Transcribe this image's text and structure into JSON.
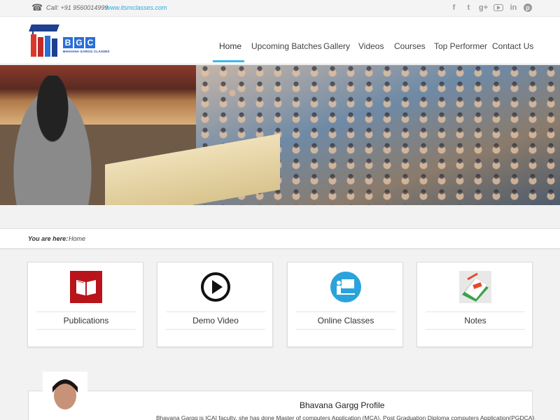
{
  "topbar": {
    "call": "Call: +91 9560014999",
    "site": "www.itsmclasses.com",
    "social_icons": [
      "facebook-icon",
      "twitter-icon",
      "google-plus-icon",
      "youtube-icon",
      "linkedin-icon",
      "pinterest-icon"
    ],
    "social_glyphs": {
      "facebook": "f",
      "twitter": "t",
      "google": "g+",
      "linkedin": "in",
      "pinterest": "p"
    }
  },
  "logo": {
    "letters": [
      "B",
      "G",
      "C"
    ],
    "letter_colors": [
      "#2a6fd6",
      "#2a6fd6",
      "#2a6fd6"
    ],
    "tagline": "BHAVANA GARGG CLASSES"
  },
  "nav": {
    "items": [
      {
        "label": "Home",
        "active": true
      },
      {
        "label": "Upcoming Batches"
      },
      {
        "label": "Gallery"
      },
      {
        "label": "Videos"
      },
      {
        "label": "Courses"
      },
      {
        "label": "Top Performer"
      },
      {
        "label": "Contact Us"
      }
    ],
    "accent": "#40b8e6"
  },
  "breadcrumb": {
    "label": "You are here:",
    "current": "Home"
  },
  "cards": [
    {
      "title": "Publications",
      "icon": "book-icon"
    },
    {
      "title": "Demo Video",
      "icon": "play-icon"
    },
    {
      "title": "Online Classes",
      "icon": "presentation-icon"
    },
    {
      "title": "Notes",
      "icon": "notes-icon"
    }
  ],
  "profile": {
    "title": "Bhavana Gargg Profile",
    "description": "Bhavana Gargg is ICAI faculty, she has done Master of computers Application (MCA), Post Graduation Diploma computers Application(PGDCA)"
  }
}
